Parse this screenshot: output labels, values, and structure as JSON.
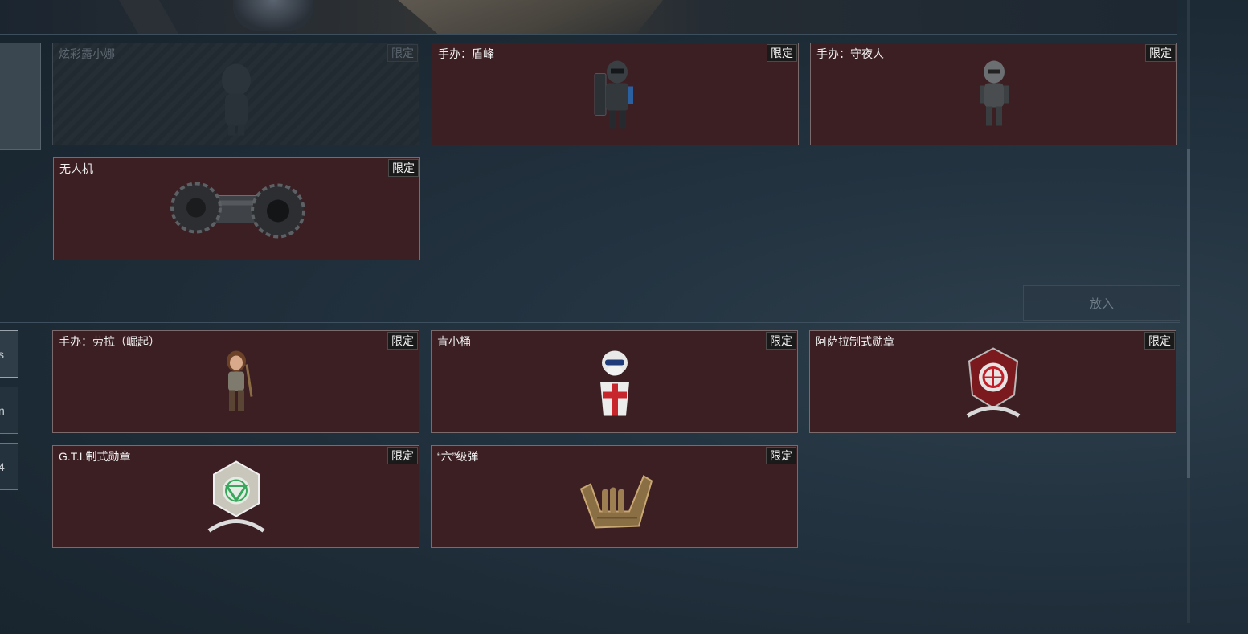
{
  "place_button": {
    "label": "放入"
  },
  "left_tabs": [
    {
      "label": "s",
      "active": true
    },
    {
      "label": "n",
      "active": false
    },
    {
      "label": "4",
      "active": false
    }
  ],
  "upper_cards": [
    {
      "title": "炫彩露小娜",
      "badge": "限定",
      "state": "disabled",
      "icon": "figure-icon"
    },
    {
      "title": "手办：盾峰",
      "badge": "限定",
      "state": "normal",
      "icon": "shield-soldier-figure-icon"
    },
    {
      "title": "手办：守夜人",
      "badge": "限定",
      "state": "normal",
      "icon": "night-watchman-figure-icon"
    },
    {
      "title": "无人机",
      "badge": "限定",
      "state": "normal",
      "icon": "drone-wheels-icon"
    }
  ],
  "lower_cards": [
    {
      "title": "手办：劳拉（崛起）",
      "badge": "限定",
      "state": "normal",
      "icon": "lara-figure-icon"
    },
    {
      "title": "肯小桶",
      "badge": "限定",
      "state": "normal",
      "icon": "colonel-figure-icon"
    },
    {
      "title": "阿萨拉制式勋章",
      "badge": "限定",
      "state": "normal",
      "icon": "red-medal-icon"
    },
    {
      "title": "G.T.I.制式勋章",
      "badge": "限定",
      "state": "normal",
      "icon": "green-medal-icon"
    },
    {
      "title": "“六”级弹",
      "badge": "限定",
      "state": "normal",
      "icon": "gesture-hand-icon"
    }
  ]
}
